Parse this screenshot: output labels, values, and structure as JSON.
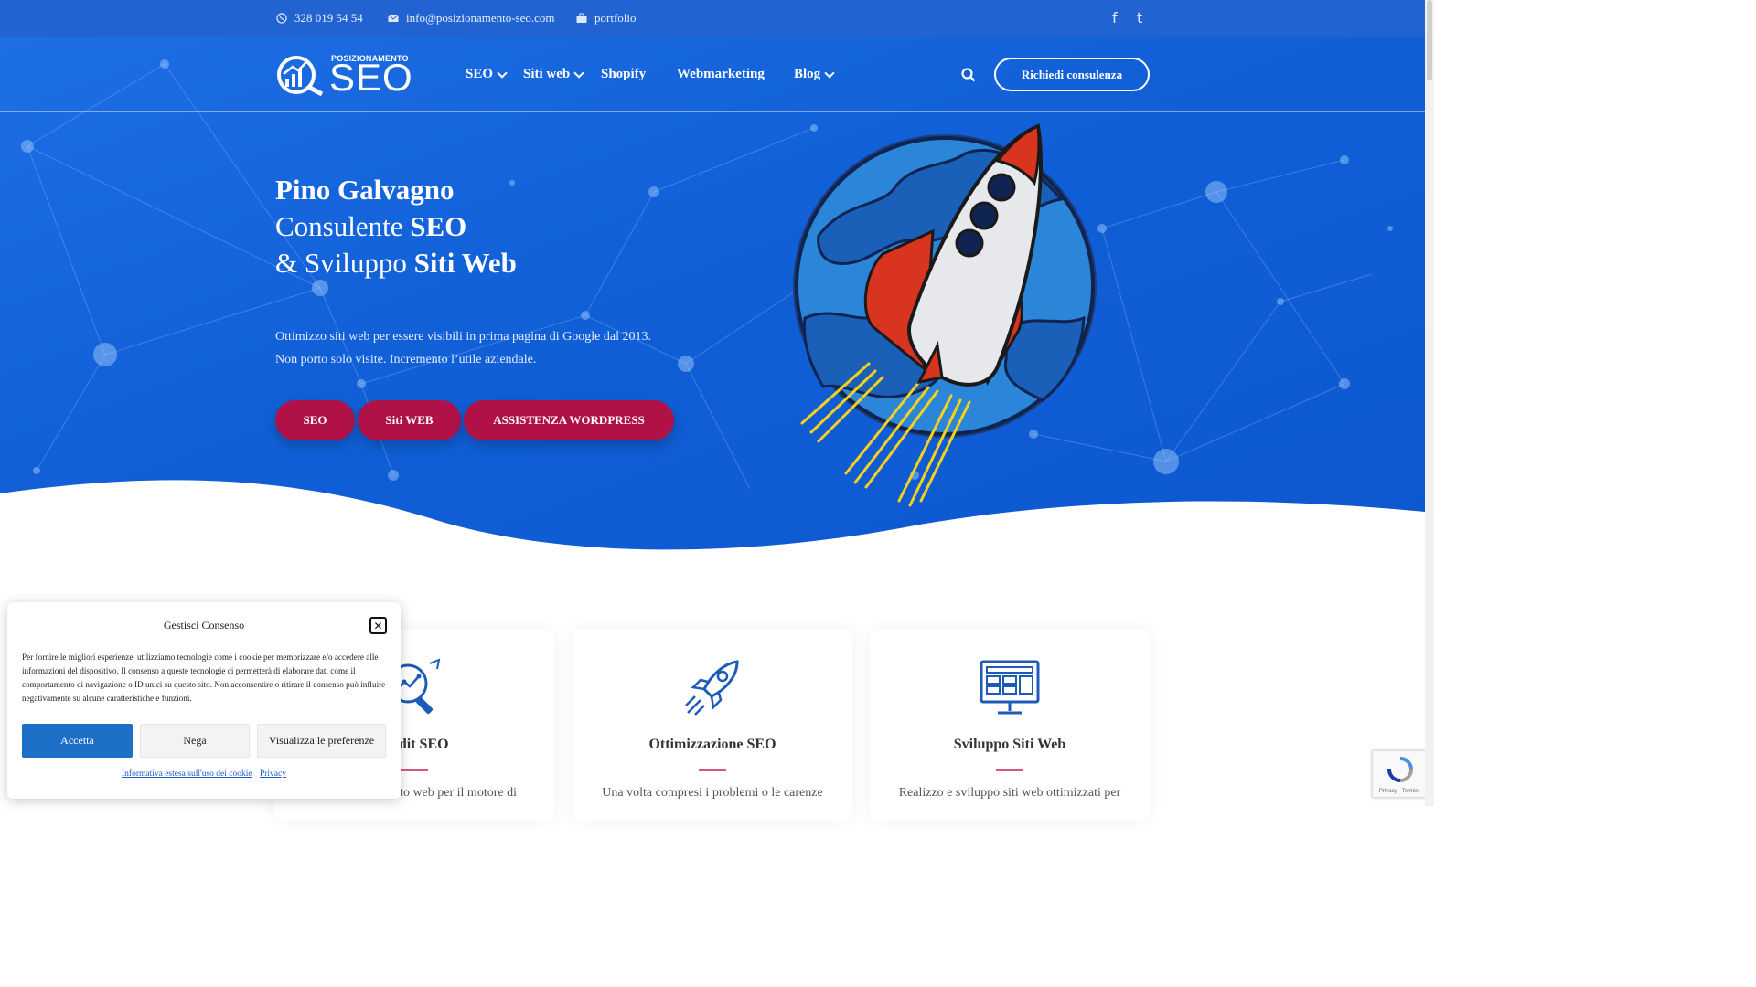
{
  "topbar": {
    "phone": "328 019 54 54",
    "email": "info@posizionamento-seo.com",
    "portfolio": "portfolio",
    "social_facebook": "f",
    "social_twitter": "t"
  },
  "logo": {
    "top": "POSIZIONAMENTO",
    "main": "SEO"
  },
  "nav": {
    "items": [
      {
        "label": "SEO",
        "dropdown": true
      },
      {
        "label": "Siti web",
        "dropdown": true
      },
      {
        "label": "Shopify",
        "dropdown": false
      },
      {
        "label": "Webmarketing",
        "dropdown": false
      },
      {
        "label": "Blog",
        "dropdown": true
      }
    ],
    "cta": "Richiedi consulenza"
  },
  "hero": {
    "name": "Pino Galvagno",
    "line2_a": "Consulente ",
    "line2_b": "SEO",
    "line3_a": "& Sviluppo ",
    "line3_b": "Siti Web",
    "sub1": "Ottimizzo siti web per essere visibili in prima pagina di Google dal 2013.",
    "sub2": "Non porto solo visite. Incremento l’utile aziendale.",
    "buttons": [
      "SEO",
      "Siti WEB",
      "ASSISTENZA WORDPRESS"
    ]
  },
  "services": [
    {
      "title": "Audit SEO",
      "text": "Analizzo il tuo sito web per il motore di",
      "icon": "magnifier-chart-icon"
    },
    {
      "title": "Ottimizzazione SEO",
      "text": "Una volta compresi i problemi o le carenze",
      "icon": "rocket-icon"
    },
    {
      "title": "Sviluppo Siti Web",
      "text": "Realizzo e sviluppo siti web ottimizzati per",
      "icon": "monitor-layout-icon"
    }
  ],
  "consent": {
    "title": "Gestisci Consenso",
    "body": "Per fornire le migliori esperienze, utilizziamo tecnologie come i cookie per memorizzare e/o accedere alle informazioni del dispositivo. Il consenso a queste tecnologie ci permetterà di elaborare dati come il comportamento di navigazione o ID unici su questo sito. Non acconsentire o ritirare il consenso può influire negativamente su alcune caratteristiche e funzioni.",
    "accept": "Accetta",
    "deny": "Nega",
    "prefs": "Visualizza le preferenze",
    "link_cookie": "Informativa estesa sull'uso dei cookie",
    "link_privacy": "Privacy"
  },
  "recaptcha": {
    "text": "Privacy - Termini"
  },
  "colors": {
    "hero_blue": "#1160d8",
    "topbar_blue": "#2164d1",
    "accent_crimson": "#b01248",
    "consent_accept": "#1e6fc8",
    "card_separator": "#d8577d"
  }
}
